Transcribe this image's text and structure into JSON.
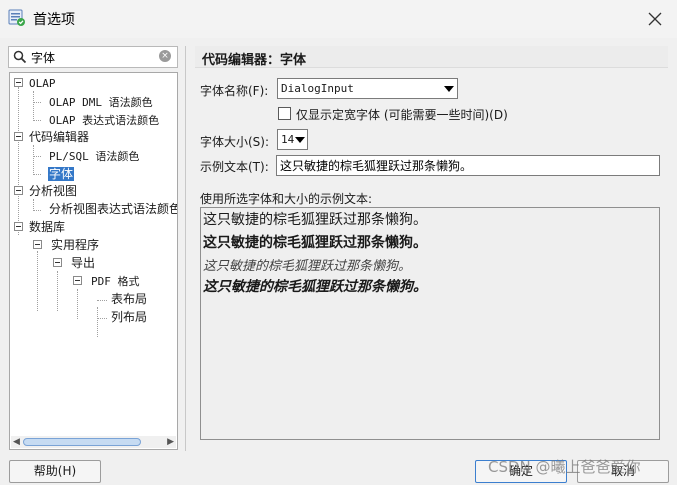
{
  "window": {
    "title": "首选项"
  },
  "search": {
    "value": "字体"
  },
  "tree": {
    "items": [
      {
        "label": "OLAP"
      },
      {
        "label": "OLAP DML 语法颜色"
      },
      {
        "label": "OLAP 表达式语法颜色"
      },
      {
        "label": "代码编辑器"
      },
      {
        "label": "PL/SQL 语法颜色"
      },
      {
        "label": "字体"
      },
      {
        "label": "分析视图"
      },
      {
        "label": "分析视图表达式语法颜色"
      },
      {
        "label": "数据库"
      },
      {
        "label": "实用程序"
      },
      {
        "label": "导出"
      },
      {
        "label": "PDF 格式"
      },
      {
        "label": "表布局"
      },
      {
        "label": "列布局"
      }
    ]
  },
  "panel": {
    "title": "代码编辑器：字体",
    "font_name_label": "字体名称(F):",
    "font_name_value": "DialogInput",
    "fixed_width_label": "仅显示定宽字体 (可能需要一些时间)(D)",
    "font_size_label": "字体大小(S):",
    "font_size_value": "14",
    "sample_label": "示例文本(T):",
    "sample_value": "这只敏捷的棕毛狐狸跃过那条懒狗。",
    "preview_label": "使用所选字体和大小的示例文本:",
    "preview_lines": [
      "这只敏捷的棕毛狐狸跃过那条懒狗。",
      "这只敏捷的棕毛狐狸跃过那条懒狗。",
      "这只敏捷的棕毛狐狸跃过那条懒狗。",
      "这只敏捷的棕毛狐狸跃过那条懒狗。"
    ]
  },
  "buttons": {
    "help": "帮助(H)",
    "ok": "确定",
    "cancel": "取消"
  },
  "watermark": "CSDN @曦上爸爸爱你",
  "colors": {
    "selection": "#3478c8",
    "primary_border": "#3c7fcf"
  }
}
